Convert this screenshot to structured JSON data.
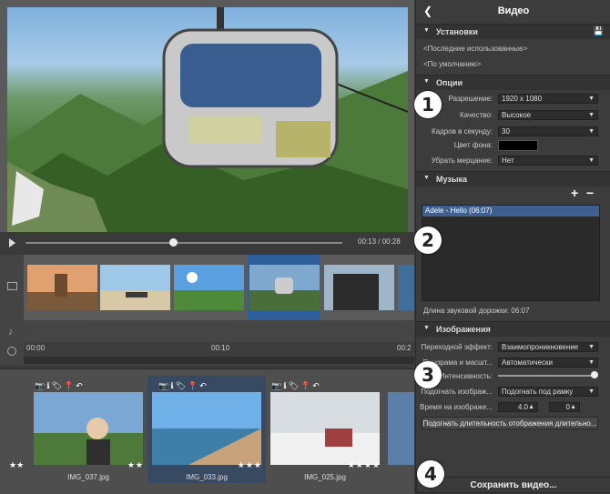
{
  "player": {
    "time": "00:13 / 00:28",
    "progress": 0.46
  },
  "timeline": {
    "ticks": [
      "00:00",
      "00:10",
      "00:2"
    ]
  },
  "browser": {
    "items": [
      {
        "name": "IMG_037.jpg",
        "stars": "★★",
        "left_stars": "★★"
      },
      {
        "name": "IMG_033.jpg",
        "stars": "★★★"
      },
      {
        "name": "IMG_025.jpg",
        "stars": "★★★★"
      }
    ],
    "icons": "📷ℹ🏷📍↶"
  },
  "panel": {
    "back_icon": "❮",
    "title": "Видео",
    "save_icon": "💾",
    "sections": {
      "settings": "Установки",
      "options": "Опции",
      "music": "Музыка",
      "images": "Изображения"
    },
    "presets": [
      "<Последние использованные>",
      "<По умолчанию>"
    ],
    "options": {
      "resolution_label": "Разрешение:",
      "resolution": "1920 x 1080",
      "quality_label": "Качество:",
      "quality": "Высокое",
      "fps_label": "Кадров в секунду:",
      "fps": "30",
      "bg_label": "Цвет фона:",
      "bg_color": "#000000",
      "flicker_label": "Убрать мерцание:",
      "flicker": "Нет"
    },
    "music": {
      "add": "+",
      "remove": "−",
      "track": "Adele - Hello (06:07)",
      "length": "Длина звуковой дорожки: 06:07"
    },
    "images": {
      "transition_label": "Переходной эффект:",
      "transition": "Взаимопроникновение",
      "pan_label": "Панорама и масшт...",
      "pan": "Автоматически",
      "intensity_label": "Интенсивность:",
      "intensity": 1.0,
      "fit_label": "Подогнать изображ...",
      "fit": "Подогнать под рамку",
      "time_label": "Время на изображе...",
      "time_sec": "4.0",
      "time_frac": "0",
      "fit_duration": "Подогнать длительность отображения длительно..."
    },
    "save_button": "Сохранить видео..."
  },
  "badges": [
    "1",
    "2",
    "3",
    "4"
  ]
}
